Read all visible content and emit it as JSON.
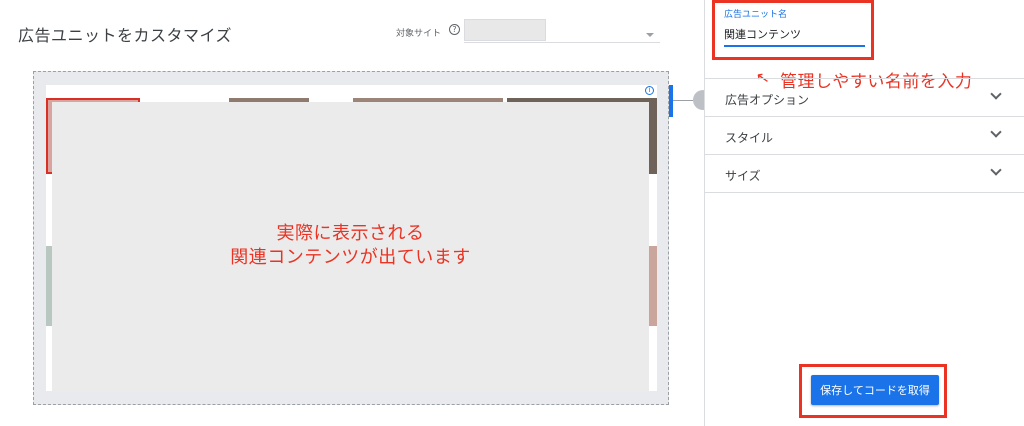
{
  "header": {
    "title": "広告ユニットをカスタマイズ",
    "site_label": "対象サイト",
    "help_icon": "?",
    "select_arrow": "caret-down-icon"
  },
  "preview": {
    "info_icon": "i",
    "overlay_line1": "実際に表示される",
    "overlay_line2": "関連コンテンツが出ています"
  },
  "panel": {
    "name_label": "広告ユニット名",
    "name_value": "関連コンテンツ",
    "annotation_arrow": "↖",
    "annotation": "管理しやすい名前を入力",
    "sections": [
      {
        "label": "広告オプション"
      },
      {
        "label": "スタイル"
      },
      {
        "label": "サイズ"
      }
    ],
    "save_label": "保存してコードを取得"
  },
  "colors": {
    "accent_blue": "#1a73e8",
    "annotation_red": "#ea3323"
  }
}
